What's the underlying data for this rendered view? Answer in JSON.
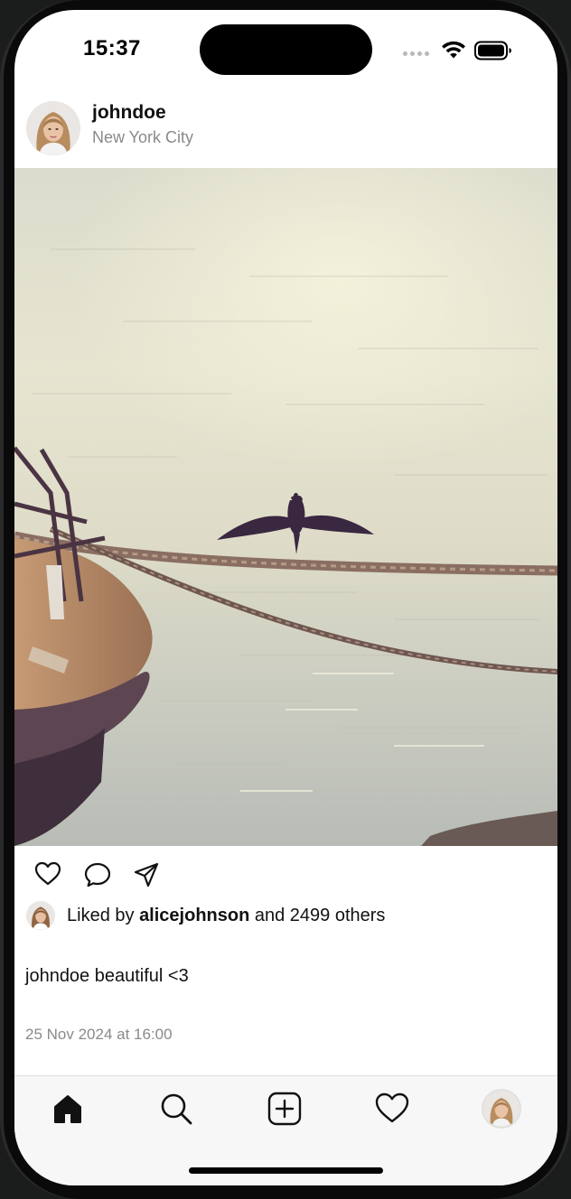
{
  "status_bar": {
    "time": "15:37"
  },
  "post": {
    "username": "johndoe",
    "location": "New York City",
    "liked_by_prefix": "Liked by",
    "liked_by_user": "alicejohnson",
    "liked_by_suffix": "and 2499 others",
    "caption": "johndoe beautiful <3",
    "timestamp": "25 Nov 2024 at 16:00"
  },
  "icons": {
    "actions": [
      "heart-icon",
      "comment-icon",
      "share-icon"
    ],
    "tabs": [
      "home-icon",
      "search-icon",
      "add-icon",
      "activity-heart-icon",
      "profile-avatar"
    ]
  },
  "colors": {
    "text_primary": "#111111",
    "text_secondary": "#8a8a8a",
    "tabbar_bg": "#f7f7f7"
  }
}
